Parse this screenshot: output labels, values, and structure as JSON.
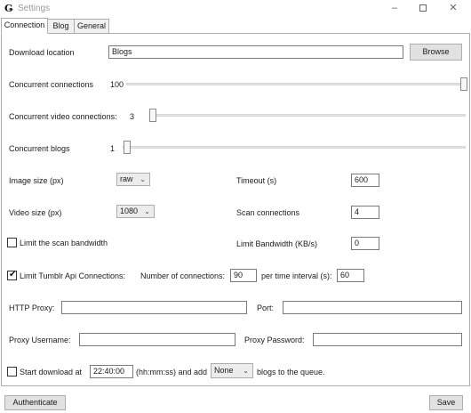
{
  "window": {
    "title": "Settings",
    "icon_char": "Ǥ",
    "minimize": "–",
    "close": "✕"
  },
  "tabs": [
    {
      "label": "Connection",
      "active": true
    },
    {
      "label": "Blog",
      "active": false
    },
    {
      "label": "General",
      "active": false
    }
  ],
  "download_location": {
    "label": "Download location",
    "value": "Blogs",
    "browse": "Browse"
  },
  "concurrent_connections": {
    "label": "Concurrent connections",
    "value": "100",
    "level": 1.0
  },
  "concurrent_video_connections": {
    "label": "Concurrent video connections:",
    "value": "3",
    "level": 0.0
  },
  "concurrent_blogs": {
    "label": "Concurrent blogs",
    "value": "1",
    "level": 0.0
  },
  "image_size": {
    "label": "Image size (px)",
    "value": "raw"
  },
  "timeout": {
    "label": "Timeout (s)",
    "value": "600"
  },
  "video_size": {
    "label": "Video size (px)",
    "value": "1080"
  },
  "scan_connections": {
    "label": "Scan connections",
    "value": "4"
  },
  "limit_scan_bandwidth": {
    "label": "Limit the scan bandwidth",
    "checked": false
  },
  "limit_bandwidth": {
    "label": "Limit Bandwidth (KB/s)",
    "value": "0"
  },
  "limit_tumblr_api": {
    "label": "Limit Tumblr Api Connections:",
    "checked": true,
    "num_label": "Number of connections:",
    "num_value": "90",
    "interval_label": "per time interval (s):",
    "interval_value": "60"
  },
  "http_proxy": {
    "label": "HTTP Proxy:",
    "value": ""
  },
  "port": {
    "label": "Port:",
    "value": ""
  },
  "proxy_username": {
    "label": "Proxy Username:",
    "value": ""
  },
  "proxy_password": {
    "label": "Proxy Password:",
    "value": ""
  },
  "start_download": {
    "label": "Start download at",
    "checked": false,
    "time": "22:40:00",
    "hint": "(hh:mm:ss) and add",
    "queue_value": "None",
    "suffix": "blogs to the queue."
  },
  "footer": {
    "authenticate": "Authenticate",
    "save": "Save"
  },
  "icons": {
    "dropdown": "⌄"
  }
}
